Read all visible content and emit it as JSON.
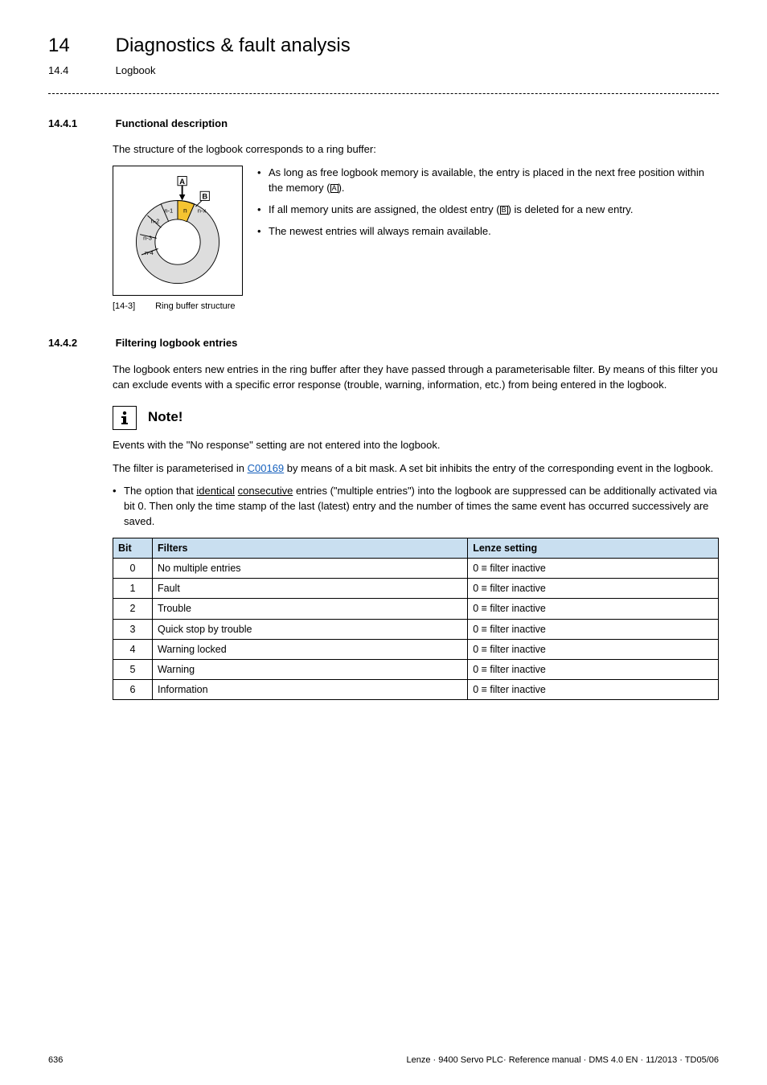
{
  "header": {
    "chapter_num": "14",
    "chapter_title": "Diagnostics & fault analysis",
    "sub_num": "14.4",
    "sub_title": "Logbook"
  },
  "s1": {
    "num": "14.4.1",
    "title": "Functional description",
    "intro": "The structure of the logbook corresponds to a ring buffer:",
    "b1a": "As long as free logbook memory is available, the entry is placed in the next free position within the memory (",
    "b1b": ").",
    "b2a": "If all memory units are assigned, the oldest entry (",
    "b2b": ") is deleted for a new entry.",
    "b3": "The newest entries will always remain available.",
    "cap_tag": "[14-3]",
    "cap_text": "Ring buffer structure"
  },
  "labels": {
    "A": "A",
    "B": "B",
    "n": "n",
    "n1": "n-1",
    "n2": "n-2",
    "n3": "n-3",
    "n4": "n-4",
    "nx": "n-x"
  },
  "s2": {
    "num": "14.4.2",
    "title": "Filtering logbook entries",
    "p1": "The logbook enters new entries in the ring buffer after they have passed through a parameterisable filter. By means of this filter you can exclude events with a specific error response (trouble, warning, information, etc.) from being entered in the logbook.",
    "note_label": "Note!",
    "note_text": "Events with the \"No response\" setting are not entered into the logbook.",
    "p2a": "The filter is parameterised in ",
    "p2_link": "C00169",
    "p2b": " by means of a bit mask. A set bit inhibits the entry of the corresponding event in the logbook.",
    "bullet_a": "The option that ",
    "bullet_u1": "identical",
    "bullet_mid": " ",
    "bullet_u2": "consecutive",
    "bullet_b": " entries (\"multiple entries\") into the logbook are suppressed can be additionally activated via bit 0. Then only the time stamp of the last (latest) entry and the number of times the same event has occurred successively are saved."
  },
  "table": {
    "h_bit": "Bit",
    "h_filters": "Filters",
    "h_setting": "Lenze setting",
    "rows": [
      {
        "bit": "0",
        "filter": "No multiple entries",
        "setting": "0 ≡ filter inactive"
      },
      {
        "bit": "1",
        "filter": "Fault",
        "setting": "0 ≡ filter inactive"
      },
      {
        "bit": "2",
        "filter": "Trouble",
        "setting": "0 ≡ filter inactive"
      },
      {
        "bit": "3",
        "filter": "Quick stop by trouble",
        "setting": "0 ≡ filter inactive"
      },
      {
        "bit": "4",
        "filter": "Warning locked",
        "setting": "0 ≡ filter inactive"
      },
      {
        "bit": "5",
        "filter": "Warning",
        "setting": "0 ≡ filter inactive"
      },
      {
        "bit": "6",
        "filter": "Information",
        "setting": "0 ≡ filter inactive"
      }
    ]
  },
  "footer": {
    "page": "636",
    "info": "Lenze · 9400 Servo PLC· Reference manual · DMS 4.0 EN · 11/2013 · TD05/06"
  }
}
